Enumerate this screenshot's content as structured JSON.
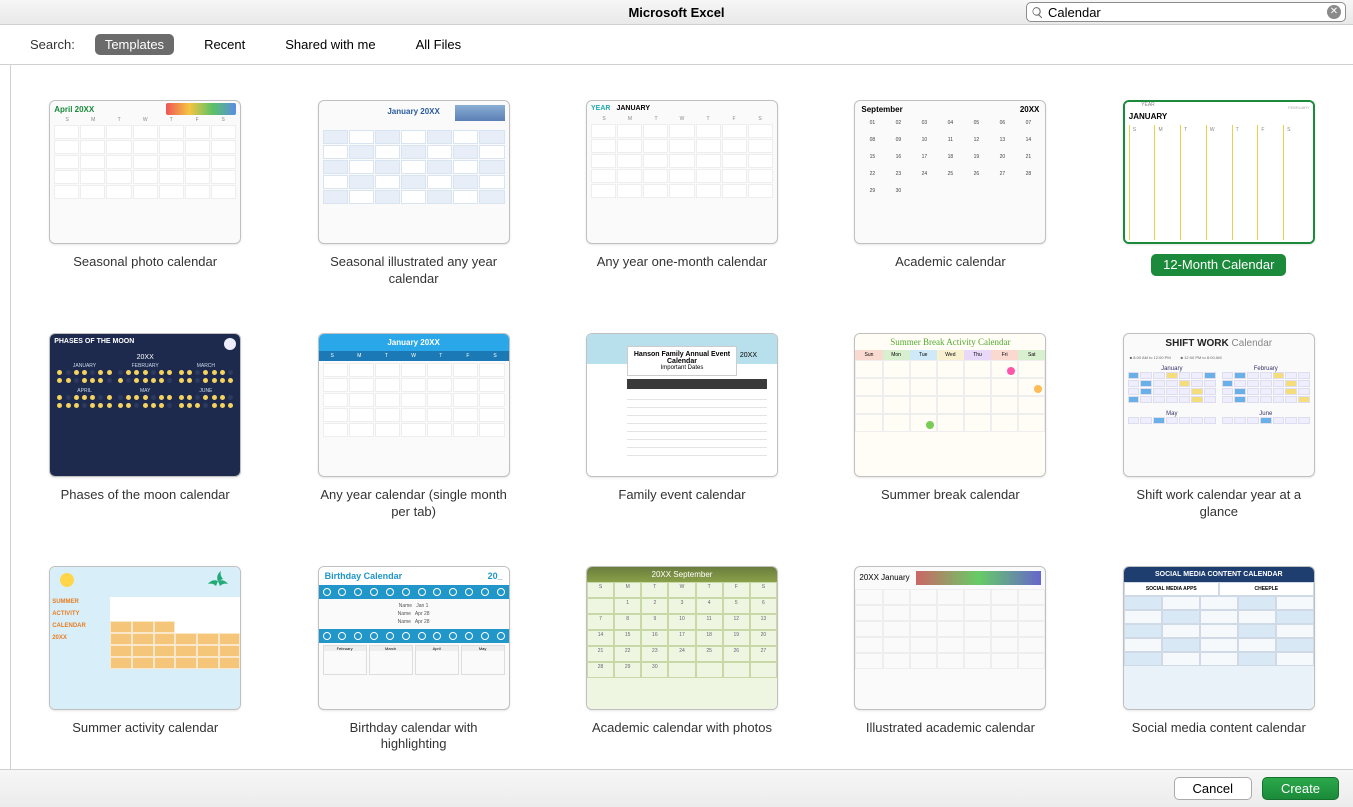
{
  "app_title": "Microsoft Excel",
  "search": {
    "value": "Calendar"
  },
  "filter": {
    "label": "Search:",
    "tabs": [
      "Templates",
      "Recent",
      "Shared with me",
      "All Files"
    ],
    "active": "Templates"
  },
  "footer": {
    "cancel": "Cancel",
    "create": "Create"
  },
  "templates": [
    {
      "name": "Seasonal photo calendar",
      "key": "seasonal-photo",
      "selected": false,
      "preview": {
        "title": "April 20XX"
      }
    },
    {
      "name": "Seasonal illustrated any year calendar",
      "key": "seasonal-illustrated",
      "selected": false,
      "preview": {
        "title": "January 20XX"
      }
    },
    {
      "name": "Any year one-month calendar",
      "key": "any-year-one-month",
      "selected": false,
      "preview": {
        "year": "YEAR",
        "month": "JANUARY"
      }
    },
    {
      "name": "Academic calendar",
      "key": "academic",
      "selected": false,
      "preview": {
        "month": "September",
        "year": "20XX"
      }
    },
    {
      "name": "12-Month Calendar",
      "key": "12-month",
      "selected": true,
      "preview": {
        "year": "YEAR",
        "month": "JANUARY",
        "corner": "FEBRUARY"
      }
    },
    {
      "name": "Phases of the moon calendar",
      "key": "moon",
      "selected": false,
      "preview": {
        "title": "PHASES OF THE MOON",
        "year": "20XX",
        "months1": [
          "JANUARY",
          "FEBRUARY",
          "MARCH"
        ],
        "months2": [
          "APRIL",
          "MAY",
          "JUNE"
        ]
      }
    },
    {
      "name": "Any year calendar (single month per tab)",
      "key": "any-year-single",
      "selected": false,
      "preview": {
        "title": "January 20XX"
      }
    },
    {
      "name": "Family event calendar",
      "key": "family-event",
      "selected": false,
      "preview": {
        "title": "Hanson Family Annual Event Calendar",
        "sub": "Important Dates",
        "year": "20XX"
      }
    },
    {
      "name": "Summer break calendar",
      "key": "summer-break",
      "selected": false,
      "preview": {
        "title": "Summer Break Activity Calendar"
      }
    },
    {
      "name": "Shift work calendar year at a glance",
      "key": "shift-work",
      "selected": false,
      "preview": {
        "title_bold": "SHIFT WORK",
        "title_rest": "Calendar",
        "months": [
          "January",
          "February",
          "May",
          "June"
        ]
      }
    },
    {
      "name": "Summer activity calendar",
      "key": "summer-activity",
      "selected": false,
      "preview": {
        "label1": "SUMMER",
        "label2": "ACTIVITY",
        "label3": "CALENDAR",
        "year": "20XX"
      }
    },
    {
      "name": "Birthday calendar with highlighting",
      "key": "birthday",
      "selected": false,
      "preview": {
        "title": "Birthday Calendar",
        "year": "20_",
        "months": [
          "February",
          "March",
          "April",
          "May"
        ]
      }
    },
    {
      "name": "Academic calendar with photos",
      "key": "academic-photos",
      "selected": false,
      "preview": {
        "title": "20XX September"
      }
    },
    {
      "name": "Illustrated academic calendar",
      "key": "illustrated-academic",
      "selected": false,
      "preview": {
        "title": "20XX January"
      }
    },
    {
      "name": "Social media content calendar",
      "key": "social-media",
      "selected": false,
      "preview": {
        "title": "SOCIAL MEDIA CONTENT CALENDAR",
        "col1": "SOCIAL MEDIA APPS",
        "col2": "CHEEPLE"
      }
    }
  ]
}
